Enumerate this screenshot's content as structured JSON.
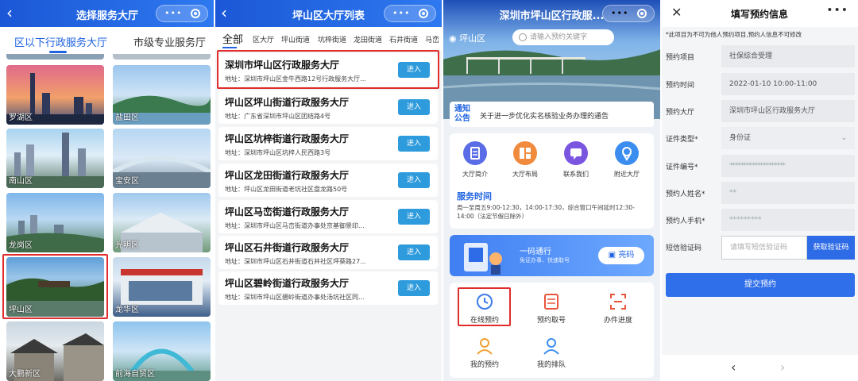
{
  "panel1": {
    "title": "选择服务大厅",
    "back_icon": "chevron-left-icon",
    "tabs": [
      {
        "label": "区以下行政服务大厅",
        "active": true
      },
      {
        "label": "市级专业服务厅",
        "active": false
      }
    ],
    "districts": [
      {
        "label": "罗湖区"
      },
      {
        "label": "盐田区"
      },
      {
        "label": "南山区"
      },
      {
        "label": "宝安区"
      },
      {
        "label": "龙岗区"
      },
      {
        "label": "光明区"
      },
      {
        "label": "坪山区"
      },
      {
        "label": "龙华区"
      },
      {
        "label": "大鹏新区"
      },
      {
        "label": "前海自贸区"
      }
    ]
  },
  "panel2": {
    "title": "坪山区大厅列表",
    "tabs": [
      "全部",
      "区大厅",
      "坪山街道",
      "坑梓街道",
      "龙田街道",
      "石井街道",
      "马峦"
    ],
    "enter_label": "进入",
    "halls": [
      {
        "name": "深圳市坪山区行政服务大厅",
        "address": "地址：深圳市坪山区金牛西路12号行政服务大厅..."
      },
      {
        "name": "坪山区坪山街道行政服务大厅",
        "address": "地址：广东省深圳市坪山区团结路4号"
      },
      {
        "name": "坪山区坑梓街道行政服务大厅",
        "address": "地址：深圳市坪山区坑梓人民西路3号"
      },
      {
        "name": "坪山区龙田街道行政服务大厅",
        "address": "地址：坪山区龙田街道老坑社区盘龙路50号"
      },
      {
        "name": "坪山区马峦街道行政服务大厅",
        "address": "地址：深圳市坪山区马峦街道办事处京基御景印..."
      },
      {
        "name": "坪山区石井街道行政服务大厅",
        "address": "地址：深圳市坪山区石井街道石井社区坪葵路27..."
      },
      {
        "name": "坪山区碧岭街道行政服务大厅",
        "address": "地址：深圳市坪山区碧岭街道办事处汤坑社区同..."
      }
    ]
  },
  "panel3": {
    "title": "深圳市坪山区行政服...",
    "location": "坪山区",
    "search_placeholder": "请输入预约关键字",
    "notice_tag": "通知公告",
    "notice_text": "关于进一步优化实名核验业务办理的通告",
    "quick_items": [
      {
        "label": "大厅简介",
        "icon": "document-icon",
        "color": "#5b6de6"
      },
      {
        "label": "大厅布局",
        "icon": "layout-icon",
        "color": "#f08a3c"
      },
      {
        "label": "联系我们",
        "icon": "chat-icon",
        "color": "#7a55e0"
      },
      {
        "label": "附近大厅",
        "icon": "location-pin-icon",
        "color": "#3b8ef0"
      }
    ],
    "service_time_title": "服务时间",
    "service_time_text": "周一至周五9:00-12:30，14:00-17:30，综合窗口午间延时12:30-14:00（法定节假日除外）",
    "banner_title": "一码通行",
    "banner_sub": "免证办事、快速取号",
    "banner_button": "亮码",
    "grid_items": [
      {
        "label": "在线预约",
        "icon": "clock-icon"
      },
      {
        "label": "预约取号",
        "icon": "ticket-icon"
      },
      {
        "label": "办件进度",
        "icon": "scan-icon"
      },
      {
        "label": "我的预约",
        "icon": "person-icon"
      },
      {
        "label": "我的排队",
        "icon": "people-icon"
      }
    ]
  },
  "panel4": {
    "title": "填写预约信息",
    "note": "*此项目为不可为他人预约项目,预约人信息不可修改",
    "fields": [
      {
        "label": "预约项目",
        "value": "社保综合受理"
      },
      {
        "label": "预约时间",
        "value": "2022-01-10  10:00-11:00"
      },
      {
        "label": "预约大厅",
        "value": "深圳市坪山区行政服务大厅"
      },
      {
        "label": "证件类型*",
        "value": "身份证"
      },
      {
        "label": "证件编号*",
        "value": "********************"
      },
      {
        "label": "预约人姓名*",
        "value": "**"
      },
      {
        "label": "预约人手机*",
        "value": "*********"
      }
    ],
    "sms_label": "短信验证码",
    "sms_placeholder": "请填写短信验证码",
    "get_code_label": "获取验证码",
    "submit_label": "提交预约"
  }
}
